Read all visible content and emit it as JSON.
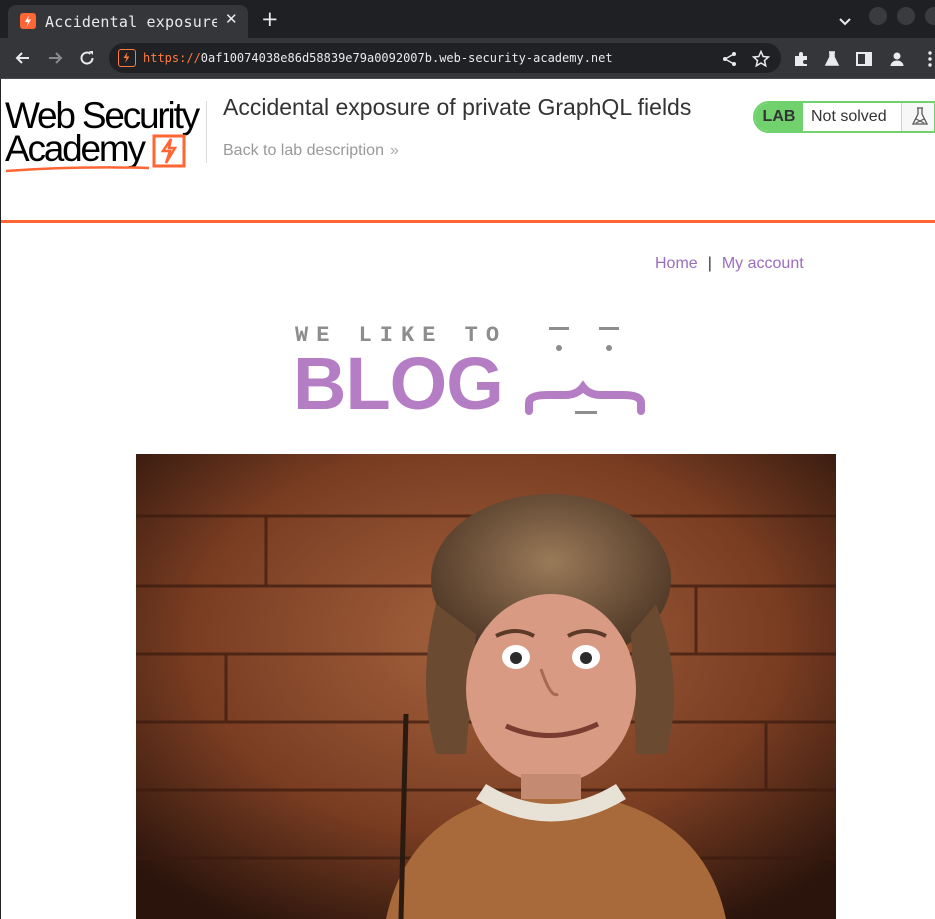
{
  "browser": {
    "tab_title": "Accidental exposure of private GraphQL fields",
    "url_scheme": "https://",
    "url_host": "0af10074038e86d58839e79a0092007b.web-security-academy.net"
  },
  "header": {
    "logo_line1": "Web Security",
    "logo_line2": "Academy",
    "lab_title": "Accidental exposure of private GraphQL fields",
    "back_link": "Back to lab description",
    "back_chevron": "»",
    "status_badge": "LAB",
    "status_text": "Not solved",
    "accent_color": "#ff6633",
    "status_color": "#70d16d"
  },
  "nav": {
    "home": "Home",
    "separator": "|",
    "account": "My account",
    "link_color": "#9b6cc0"
  },
  "banner": {
    "tagline": "WE LIKE TO",
    "word": "BLOG",
    "brand_color": "#b57ec4"
  },
  "hero": {
    "description_icon": "person-photo"
  }
}
